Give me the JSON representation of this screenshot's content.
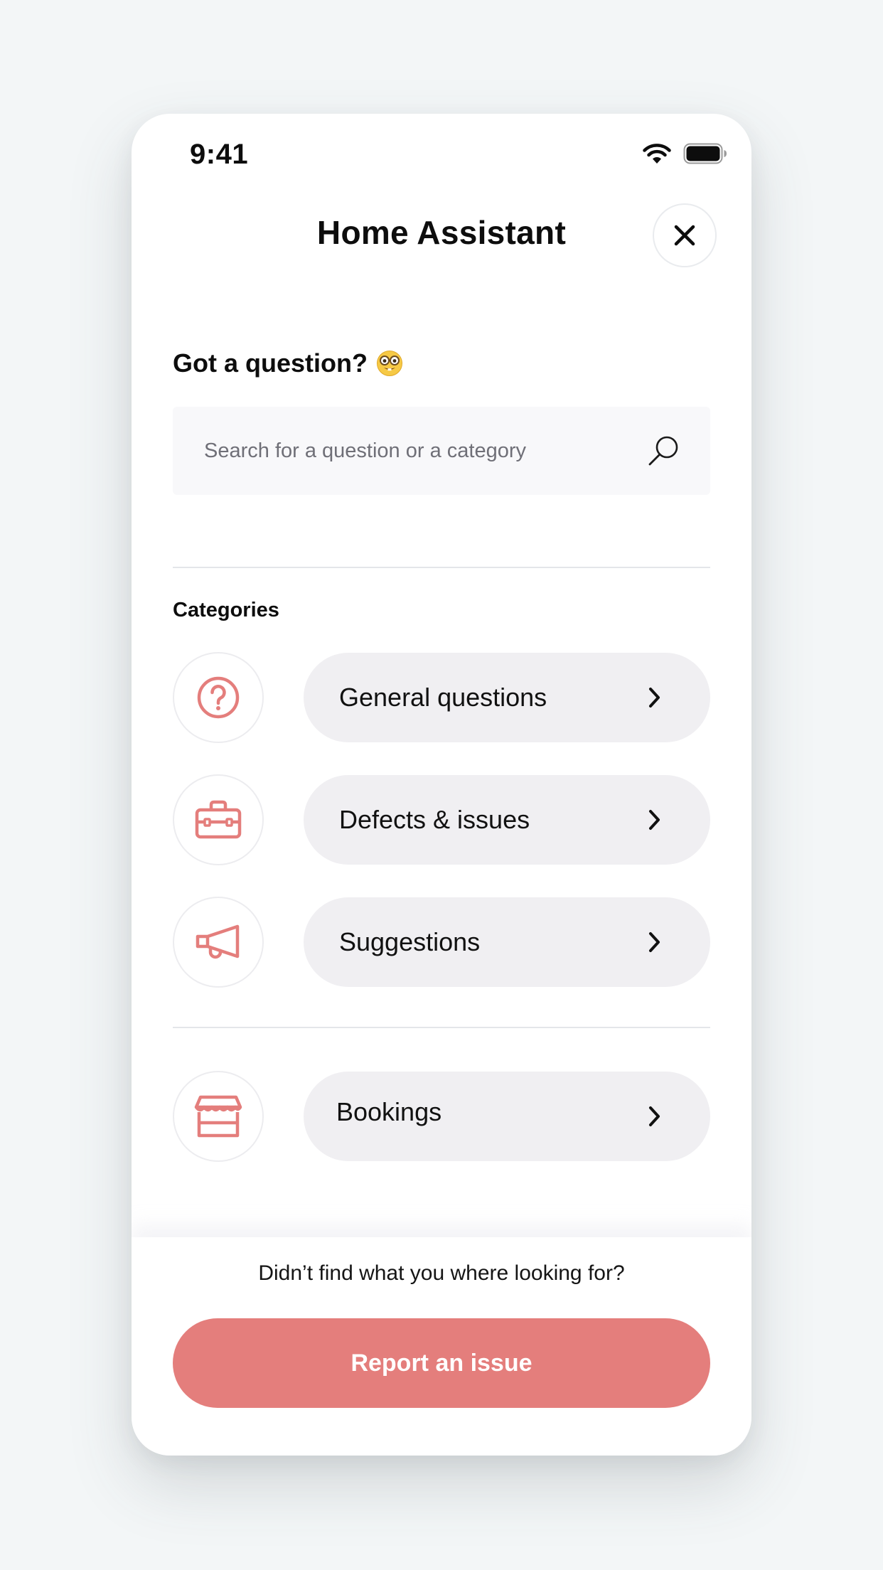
{
  "status_bar": {
    "time": "9:41"
  },
  "header": {
    "title": "Home Assistant"
  },
  "question": {
    "heading": "Got a question?",
    "emoji": "nerd-face-icon"
  },
  "search": {
    "placeholder": "Search for a question or a category",
    "value": ""
  },
  "categories": {
    "heading": "Categories",
    "items": [
      {
        "label": "General questions",
        "icon": "question-circle-icon"
      },
      {
        "label": "Defects & issues",
        "icon": "toolbox-icon"
      },
      {
        "label": "Suggestions",
        "icon": "megaphone-icon"
      }
    ],
    "extra_items": [
      {
        "label": "Bookings",
        "icon": "storefront-icon"
      }
    ]
  },
  "footer": {
    "prompt": "Didn’t find what you where looking for?",
    "report_label": "Report an issue"
  },
  "colors": {
    "accent": "#e47e7c",
    "pill_background": "#f0eff2",
    "page_background": "#f3f6f7"
  }
}
